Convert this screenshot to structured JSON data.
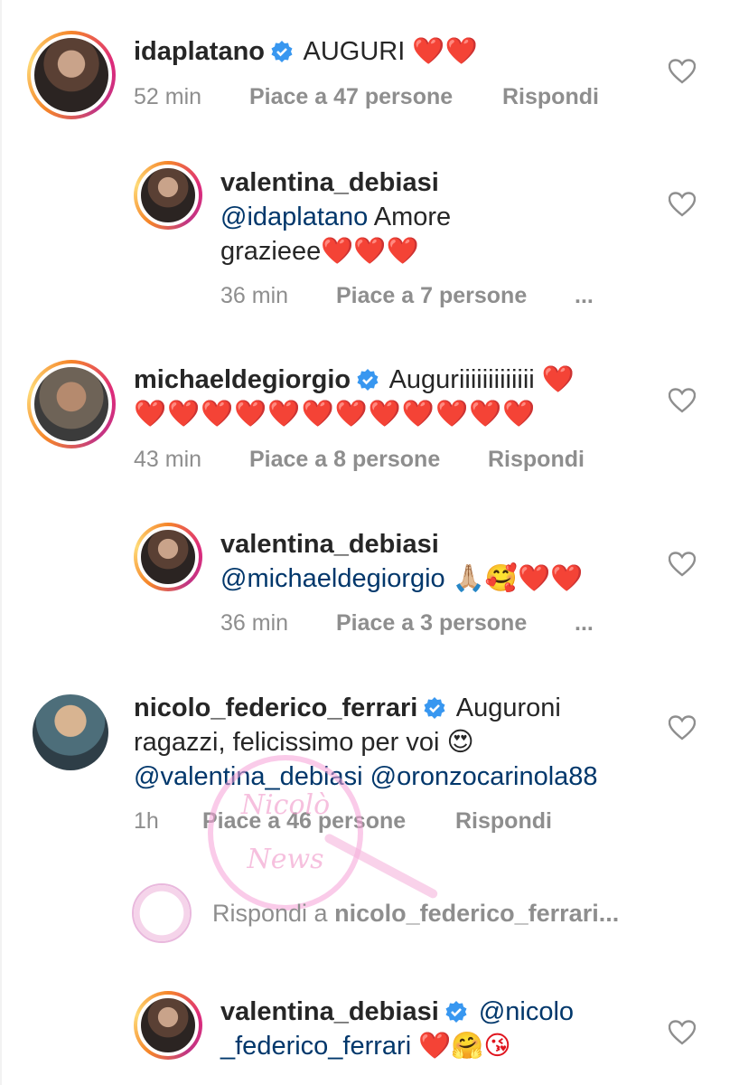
{
  "comments": [
    {
      "username": "idaplatano",
      "verified": true,
      "text": "AUGURI",
      "emoji": "❤️❤️",
      "time": "52 min",
      "likes": "Piace a 47 persone",
      "action": "Rispondi"
    },
    {
      "username": "valentina_debiasi",
      "verified": false,
      "mention": "@idaplatano",
      "text_line1": " Amore",
      "text_line2": "grazieee",
      "emoji": "❤️❤️❤️",
      "time": "36 min",
      "likes": "Piace a 7 persone",
      "action": "..."
    },
    {
      "username": "michaeldegiorgio",
      "verified": true,
      "text": "Auguriiiiiiiiiiiii",
      "emoji_line1": "❤️",
      "emoji_line2": "❤️❤️❤️❤️❤️❤️❤️❤️❤️❤️❤️❤️",
      "time": "43 min",
      "likes": "Piace a 8 persone",
      "action": "Rispondi"
    },
    {
      "username": "valentina_debiasi",
      "verified": false,
      "mention": "@michaeldegiorgio",
      "emoji": "🙏🏼🥰❤️❤️",
      "time": "36 min",
      "likes": "Piace a 3 persone",
      "action": "..."
    },
    {
      "username": "nicolo_federico_ferrari",
      "verified": true,
      "text_line1": "Auguroni",
      "text_line2": "ragazzi, felicissimo per voi",
      "emoji": "😍",
      "mention1": "@valentina_debiasi",
      "mention2": "@oronzocarinola88",
      "time": "1h",
      "likes": "Piace a 46 persone",
      "action": "Rispondi"
    },
    {
      "username": "valentina_debiasi",
      "verified": true,
      "mention_line1": "@nicolo",
      "mention_line2": "_federico_ferrari",
      "emoji": "❤️🤗😘"
    }
  ],
  "reply_bar": {
    "prefix": "Rispondi a ",
    "target": "nicolo_federico_ferrari..."
  },
  "watermark": {
    "line1": "Nicolò",
    "line2": "News"
  },
  "icons": {
    "like": "heart-outline-icon",
    "verified": "verified-badge-icon"
  },
  "colors": {
    "text": "#262626",
    "secondary": "#8e8e8e",
    "mention": "#00376b",
    "verified": "#3897f0",
    "heart": "#e0141e"
  }
}
